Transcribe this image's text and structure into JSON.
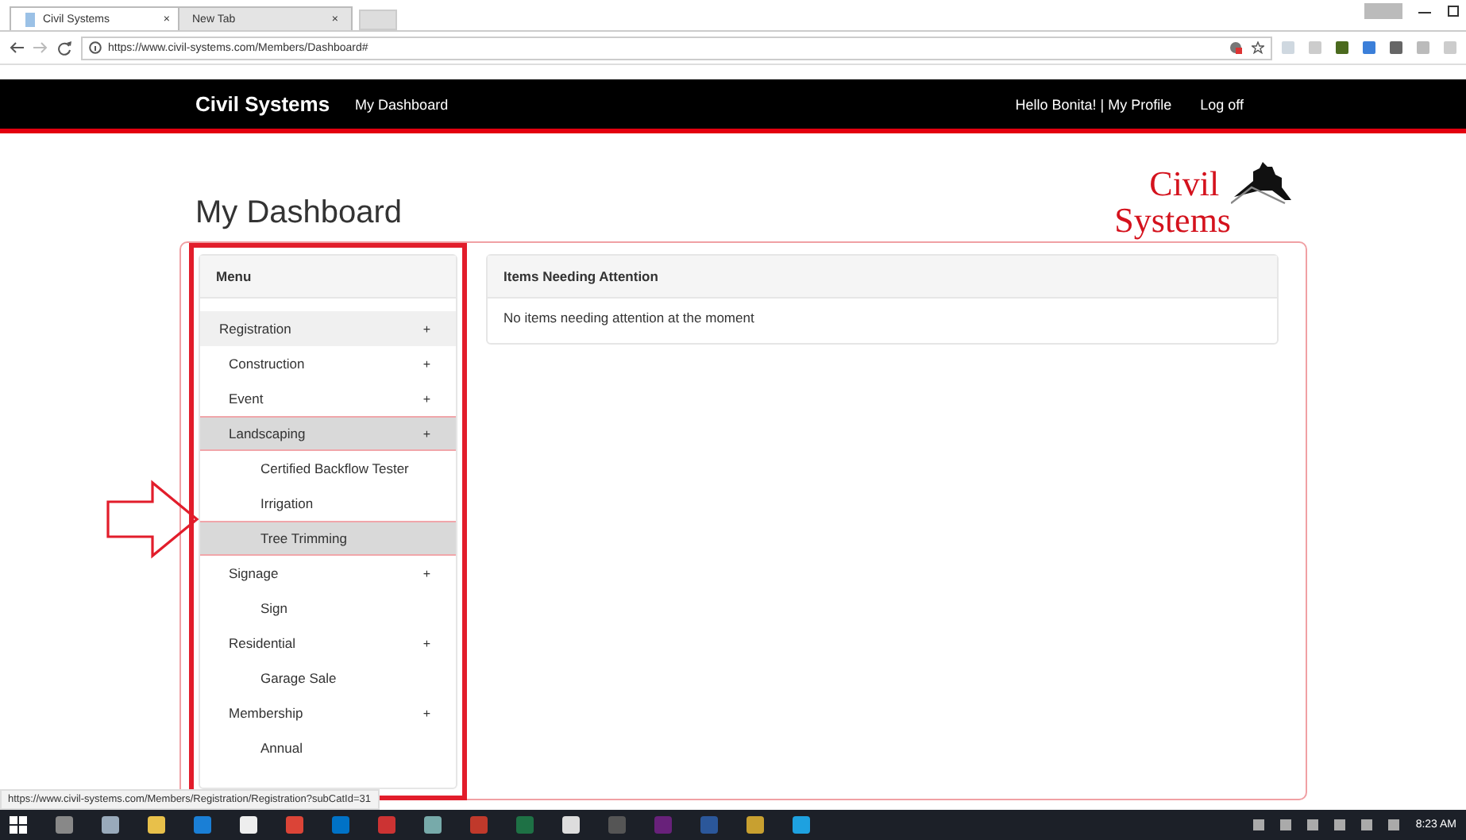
{
  "browser": {
    "tabs": [
      {
        "title": "Civil Systems",
        "close": "×",
        "selected": true
      },
      {
        "title": "New Tab",
        "close": "×",
        "selected": false
      }
    ],
    "url": "https://www.civil-systems.com/Members/Dashboard#",
    "status_url": "https://www.civil-systems.com/Members/Registration/Registration?subCatId=31"
  },
  "navbar": {
    "brand": "Civil Systems",
    "link": "My Dashboard",
    "greeting": "Hello Bonita! | My Profile",
    "logoff": "Log off"
  },
  "logo": {
    "line_1": "Civil",
    "line_2": "Systems"
  },
  "page_title": "My Dashboard",
  "menu": {
    "title": "Menu",
    "items": [
      {
        "label": "Registration",
        "toggle": "+",
        "selected": false,
        "children": [
          {
            "label": "Construction",
            "toggle": "+",
            "selected": false
          },
          {
            "label": "Event",
            "toggle": "+",
            "selected": false
          },
          {
            "label": "Landscaping",
            "toggle": "+",
            "selected": true,
            "children": [
              {
                "label": "Certified Backflow Tester",
                "selected": false
              },
              {
                "label": "Irrigation",
                "selected": false
              },
              {
                "label": "Tree Trimming",
                "selected": true
              }
            ]
          },
          {
            "label": "Signage",
            "toggle": "+",
            "selected": false,
            "children": [
              {
                "label": "Sign",
                "selected": false
              }
            ]
          },
          {
            "label": "Residential",
            "toggle": "+",
            "selected": false,
            "children": [
              {
                "label": "Garage Sale",
                "selected": false
              }
            ]
          },
          {
            "label": "Membership",
            "toggle": "+",
            "selected": false,
            "children": [
              {
                "label": "Annual",
                "selected": false
              }
            ]
          }
        ]
      }
    ]
  },
  "attention": {
    "title": "Items Needing Attention",
    "message": "No items needing attention at the moment"
  },
  "taskbar": {
    "clock": "8:23 AM"
  }
}
